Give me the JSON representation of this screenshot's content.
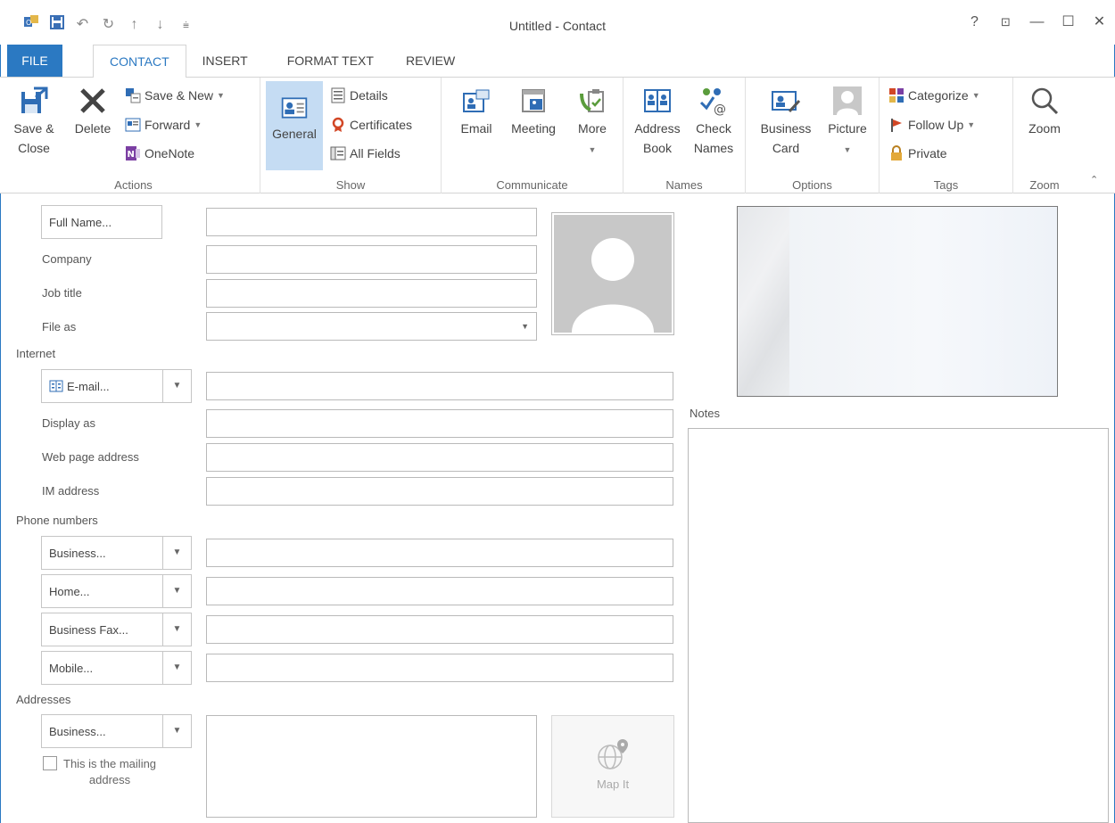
{
  "window": {
    "title": "Untitled - Contact",
    "controls": {
      "help": "?",
      "ribbon_display": "⊡",
      "minimize": "—",
      "maximize": "☐",
      "close": "✕"
    }
  },
  "tabs": [
    {
      "label": "FILE"
    },
    {
      "label": "CONTACT"
    },
    {
      "label": "INSERT"
    },
    {
      "label": "FORMAT TEXT"
    },
    {
      "label": "REVIEW"
    }
  ],
  "ribbon": {
    "actions": {
      "label": "Actions",
      "save_close": "Save &",
      "save_close_2": "Close",
      "delete": "Delete",
      "save_new": "Save & New",
      "forward": "Forward",
      "onenote": "OneNote"
    },
    "show": {
      "label": "Show",
      "general": "General",
      "details": "Details",
      "certificates": "Certificates",
      "all_fields": "All Fields"
    },
    "communicate": {
      "label": "Communicate",
      "email": "Email",
      "meeting": "Meeting",
      "more": "More"
    },
    "names": {
      "label": "Names",
      "address_book_1": "Address",
      "address_book_2": "Book",
      "check_names_1": "Check",
      "check_names_2": "Names"
    },
    "options": {
      "label": "Options",
      "business_card_1": "Business",
      "business_card_2": "Card",
      "picture": "Picture"
    },
    "tags": {
      "label": "Tags",
      "categorize": "Categorize",
      "follow_up": "Follow Up",
      "private": "Private"
    },
    "zoom": {
      "label": "Zoom",
      "zoom": "Zoom"
    }
  },
  "form": {
    "full_name_button": "Full Name...",
    "company_label": "Company",
    "job_title_label": "Job title",
    "file_as_label": "File as",
    "internet_label": "Internet",
    "email_button": "E-mail...",
    "display_as_label": "Display as",
    "web_page_label": "Web page address",
    "im_address_label": "IM address",
    "phone_numbers_label": "Phone numbers",
    "phones": [
      "Business...",
      "Home...",
      "Business Fax...",
      "Mobile..."
    ],
    "addresses_label": "Addresses",
    "address_button": "Business...",
    "mailing_address_1": "This is the mailing",
    "mailing_address_2": "address",
    "map_it": "Map It",
    "notes_label": "Notes"
  }
}
